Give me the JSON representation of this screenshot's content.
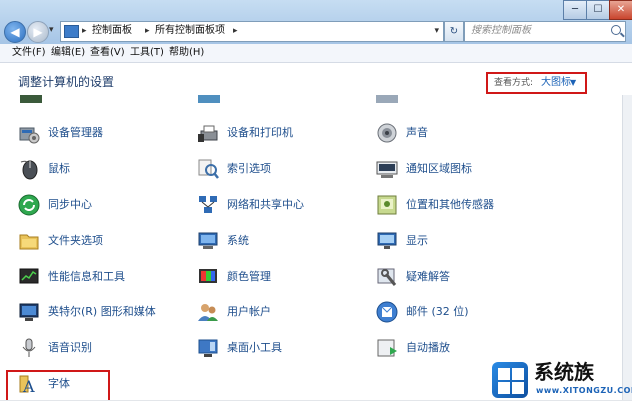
{
  "titlebar": {
    "breadcrumbs": [
      "控制面板",
      "所有控制面板项"
    ],
    "search_placeholder": "搜索控制面板",
    "window_buttons": [
      "─",
      "☐",
      "✕"
    ]
  },
  "menu": [
    {
      "label": "文件(F)"
    },
    {
      "label": "编辑(E)"
    },
    {
      "label": "查看(V)"
    },
    {
      "label": "工具(T)"
    },
    {
      "label": "帮助(H)"
    }
  ],
  "header": {
    "title": "调整计算机的设置",
    "view_by_label": "查看方式:",
    "view_by_value": "大图标"
  },
  "items": [
    {
      "label": "设备管理器",
      "icon": "device-manager-icon"
    },
    {
      "label": "设备和打印机",
      "icon": "devices-printers-icon"
    },
    {
      "label": "声音",
      "icon": "sound-icon"
    },
    {
      "label": "鼠标",
      "icon": "mouse-icon"
    },
    {
      "label": "索引选项",
      "icon": "indexing-icon"
    },
    {
      "label": "通知区域图标",
      "icon": "notification-icon"
    },
    {
      "label": "同步中心",
      "icon": "sync-center-icon"
    },
    {
      "label": "网络和共享中心",
      "icon": "network-icon"
    },
    {
      "label": "位置和其他传感器",
      "icon": "location-sensor-icon"
    },
    {
      "label": "文件夹选项",
      "icon": "folder-options-icon"
    },
    {
      "label": "系统",
      "icon": "system-icon"
    },
    {
      "label": "显示",
      "icon": "display-icon"
    },
    {
      "label": "性能信息和工具",
      "icon": "performance-icon"
    },
    {
      "label": "颜色管理",
      "icon": "color-management-icon"
    },
    {
      "label": "疑难解答",
      "icon": "troubleshooting-icon"
    },
    {
      "label": "英特尔(R) 图形和媒体",
      "icon": "intel-graphics-icon"
    },
    {
      "label": "用户帐户",
      "icon": "user-accounts-icon"
    },
    {
      "label": "邮件 (32 位)",
      "icon": "mail-icon"
    },
    {
      "label": "语音识别",
      "icon": "speech-recognition-icon"
    },
    {
      "label": "桌面小工具",
      "icon": "gadgets-icon"
    },
    {
      "label": "自动播放",
      "icon": "autoplay-icon"
    },
    {
      "label": "字体",
      "icon": "fonts-icon"
    }
  ],
  "watermark": {
    "text": "系统族",
    "url": "www.XITONGZU.COM"
  },
  "colors": {
    "link": "#1e4e8c",
    "highlight_border": "#d01818",
    "titlebar": "#b5d0ec"
  }
}
